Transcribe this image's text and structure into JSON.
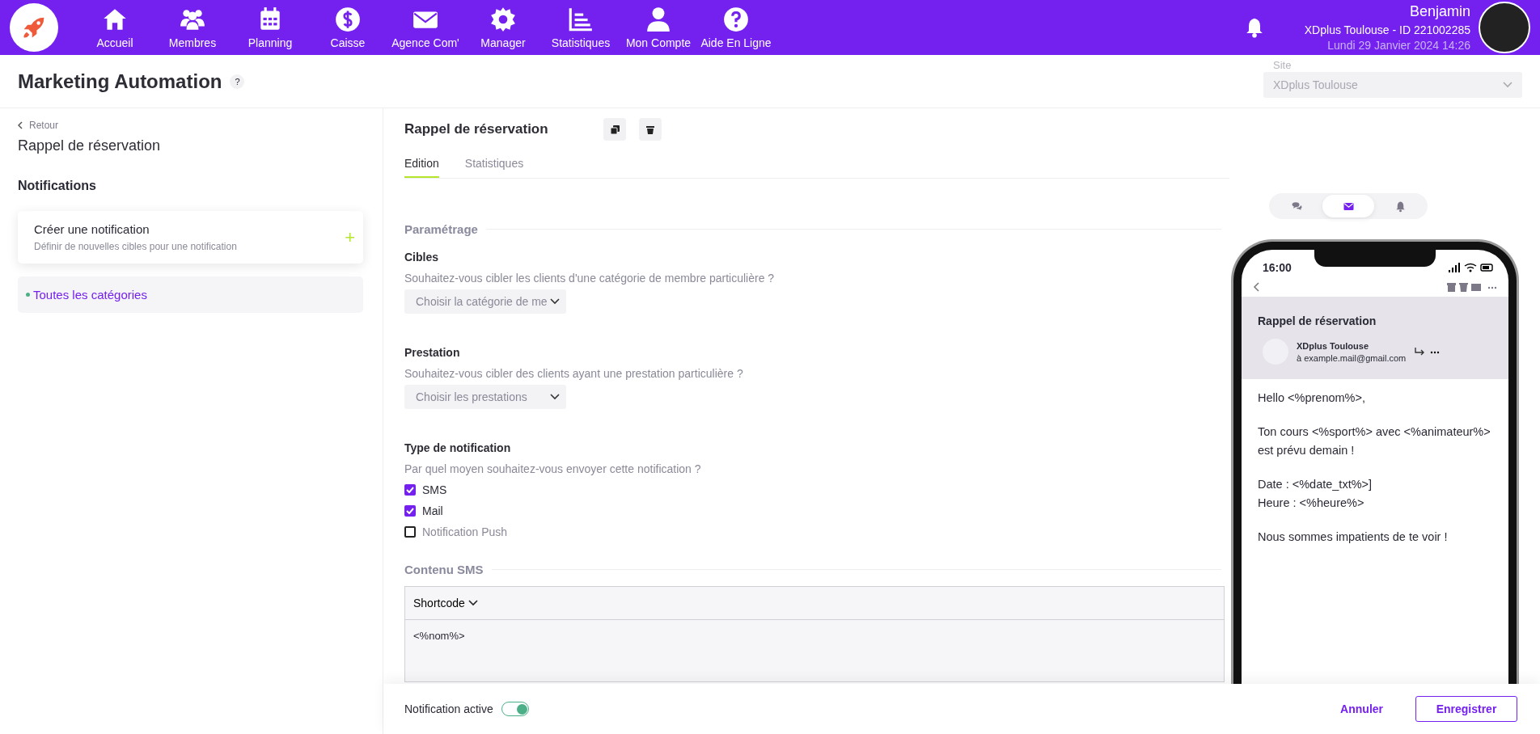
{
  "nav": {
    "items": [
      {
        "kind": "home",
        "label": "Accueil"
      },
      {
        "kind": "users",
        "label": "Membres"
      },
      {
        "kind": "calendar",
        "label": "Planning"
      },
      {
        "kind": "dollar",
        "label": "Caisse"
      },
      {
        "kind": "mail",
        "label": "Agence Com'"
      },
      {
        "kind": "gear",
        "label": "Manager"
      },
      {
        "kind": "chart",
        "label": "Statistiques"
      },
      {
        "kind": "user",
        "label": "Mon Compte"
      },
      {
        "kind": "help",
        "label": "Aide En Ligne"
      }
    ]
  },
  "user": {
    "name": "Benjamin",
    "site_id": "XDplus Toulouse - ID 221002285",
    "datetime": "Lundi 29 Janvier 2024 14:26"
  },
  "page": {
    "title": "Marketing Automation",
    "help": "?"
  },
  "site_select": {
    "label": "Site",
    "value": "XDplus Toulouse",
    "disabled": true
  },
  "sidebar": {
    "back": "Retour",
    "title": "Rappel de réservation",
    "section": "Notifications",
    "create_card": {
      "title": "Créer une notification",
      "subtitle": "Définir de nouvelles cibles pour une notification",
      "plus": "+"
    },
    "items": [
      {
        "label": "Toutes les catégories",
        "selected": true,
        "color": "#4caf87"
      }
    ]
  },
  "editor": {
    "title": "Rappel de réservation",
    "tabs": [
      {
        "label": "Edition",
        "selected": true
      },
      {
        "label": "Statistiques",
        "selected": false
      }
    ],
    "settings_heading": "Paramétrage",
    "targets": {
      "label": "Cibles",
      "question": "Souhaitez-vous cibler les clients d'une catégorie de membre particulière ?",
      "placeholder": "Choisir la catégorie de me"
    },
    "service": {
      "label": "Prestation",
      "question": "Souhaitez-vous cibler des clients ayant une prestation particulière ?",
      "placeholder": "Choisir les prestations"
    },
    "type": {
      "label": "Type de notification",
      "question": "Par quel moyen souhaitez-vous envoyer cette notification ?",
      "options": [
        {
          "label": "SMS",
          "checked": true
        },
        {
          "label": "Mail",
          "checked": true
        },
        {
          "label": "Notification Push",
          "checked": false
        }
      ]
    },
    "sms": {
      "heading": "Contenu SMS",
      "shortcode": "Shortcode",
      "content": "<%nom%>"
    }
  },
  "preview": {
    "channels": [
      {
        "kind": "chat",
        "selected": false
      },
      {
        "kind": "mail",
        "selected": true
      },
      {
        "kind": "bell",
        "selected": false
      }
    ],
    "phone": {
      "time": "16:00",
      "subject": "Rappel de réservation",
      "sender": "XDplus Toulouse",
      "recipient": "à example.mail@gmail.com",
      "paragraphs": [
        [
          "Hello <%prenom%>,"
        ],
        [
          "Ton cours <%sport%> avec <%animateur%> est prévu demain !"
        ],
        [
          "Date : <%date_txt%>]",
          "Heure : <%heure%>"
        ],
        [
          "Nous sommes impatients de te voir !"
        ]
      ]
    }
  },
  "footer": {
    "active_label": "Notification active",
    "active": true,
    "cancel": "Annuler",
    "save": "Enregistrer"
  }
}
